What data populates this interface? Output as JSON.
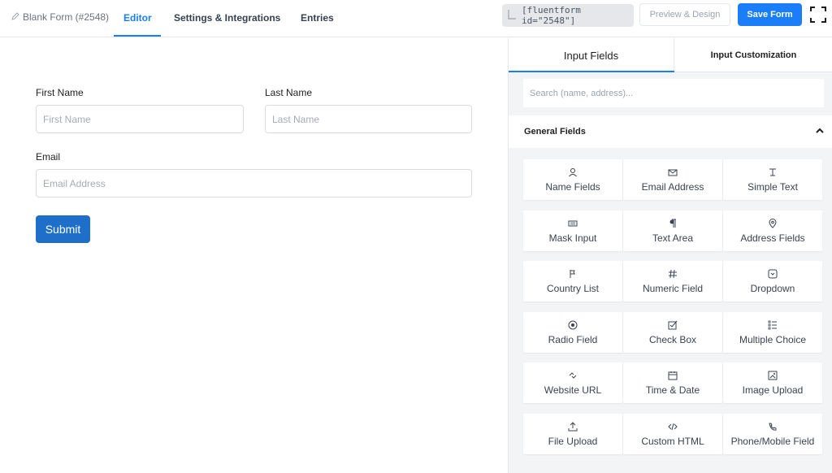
{
  "topbar": {
    "form_name": "Blank Form (#2548)",
    "tabs": [
      {
        "label": "Editor",
        "active": true
      },
      {
        "label": "Settings & Integrations",
        "active": false
      },
      {
        "label": "Entries",
        "active": false
      }
    ],
    "shortcode": "[fluentform id=\"2548\"]",
    "preview_label": "Preview & Design",
    "save_label": "Save Form"
  },
  "form": {
    "first_name_label": "First Name",
    "first_name_placeholder": "First Name",
    "last_name_label": "Last Name",
    "last_name_placeholder": "Last Name",
    "email_label": "Email",
    "email_placeholder": "Email Address",
    "submit_label": "Submit"
  },
  "sidebar": {
    "tabs": [
      {
        "label": "Input Fields",
        "active": true
      },
      {
        "label": "Input Customization",
        "active": false
      }
    ],
    "search_placeholder": "Search (name, address)...",
    "section_title": "General Fields",
    "fields": [
      {
        "label": "Name Fields",
        "icon": "user-icon"
      },
      {
        "label": "Email Address",
        "icon": "envelope-icon"
      },
      {
        "label": "Simple Text",
        "icon": "text-icon"
      },
      {
        "label": "Mask Input",
        "icon": "keyboard-icon"
      },
      {
        "label": "Text Area",
        "icon": "paragraph-icon"
      },
      {
        "label": "Address Fields",
        "icon": "map-pin-icon"
      },
      {
        "label": "Country List",
        "icon": "flag-icon"
      },
      {
        "label": "Numeric Field",
        "icon": "hash-icon"
      },
      {
        "label": "Dropdown",
        "icon": "dropdown-icon"
      },
      {
        "label": "Radio Field",
        "icon": "radio-icon"
      },
      {
        "label": "Check Box",
        "icon": "checkbox-icon"
      },
      {
        "label": "Multiple Choice",
        "icon": "list-icon"
      },
      {
        "label": "Website URL",
        "icon": "link-icon"
      },
      {
        "label": "Time & Date",
        "icon": "calendar-icon"
      },
      {
        "label": "Image Upload",
        "icon": "image-icon"
      },
      {
        "label": "File Upload",
        "icon": "upload-icon"
      },
      {
        "label": "Custom HTML",
        "icon": "code-icon"
      },
      {
        "label": "Phone/Mobile Field",
        "icon": "phone-icon"
      }
    ]
  },
  "colors": {
    "accent": "#1a7efb",
    "submit": "#1e6fc9"
  }
}
